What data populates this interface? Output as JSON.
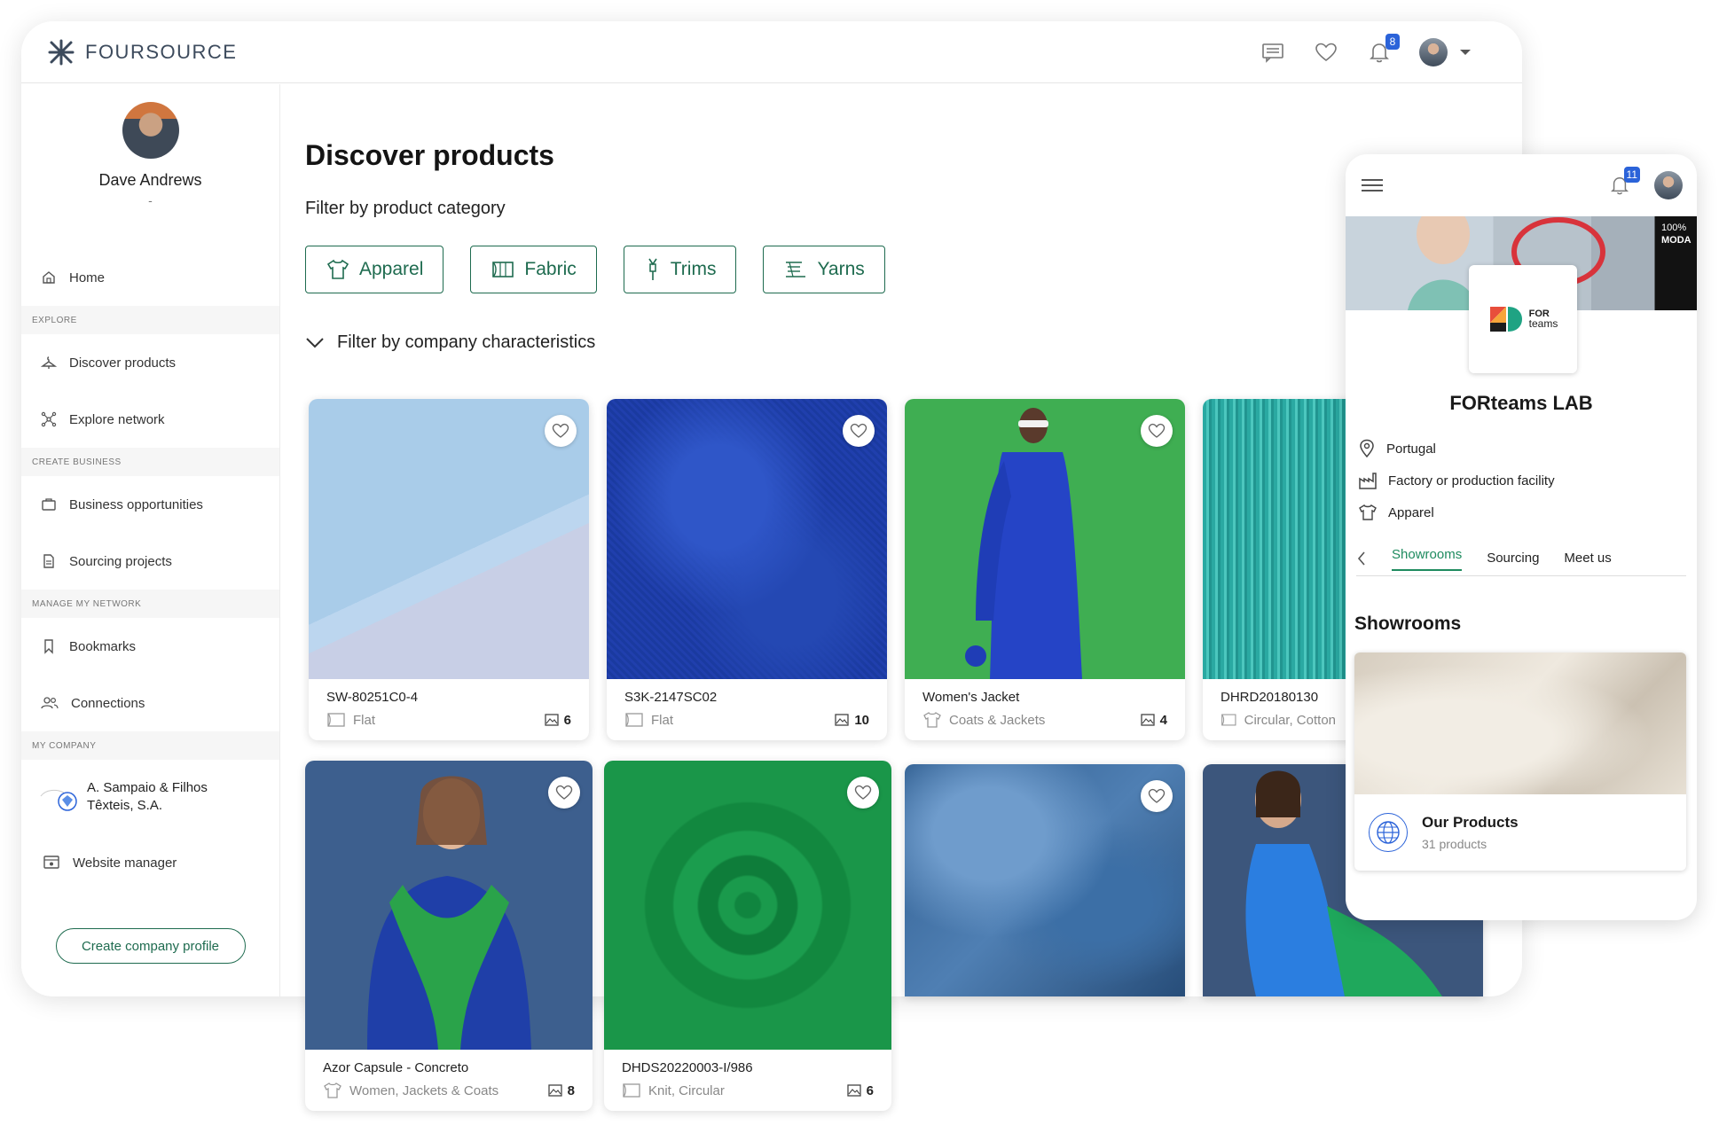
{
  "brand": {
    "name": "FOURSOURCE"
  },
  "topbar": {
    "notification_count": "8"
  },
  "sidebar": {
    "user_name": "Dave Andrews",
    "user_sub": "-",
    "home": "Home",
    "sections": {
      "explore": "Explore",
      "create_business": "Create business",
      "manage_network": "Manage my network",
      "my_company": "My company"
    },
    "items": {
      "discover": "Discover products",
      "explore_network": "Explore network",
      "business_opportunities": "Business opportunities",
      "sourcing_projects": "Sourcing projects",
      "bookmarks": "Bookmarks",
      "connections": "Connections",
      "website_manager": "Website manager"
    },
    "company_name": "A. Sampaio & Filhos Têxteis, S.A.",
    "create_profile_button": "Create company profile"
  },
  "main": {
    "title": "Discover products",
    "filter_category_label": "Filter by product category",
    "categories": [
      "Apparel",
      "Fabric",
      "Trims",
      "Yarns"
    ],
    "filter_company_label": "Filter by company characteristics"
  },
  "products": [
    {
      "code": "SW-80251C0-4",
      "meta": "Flat",
      "count": "6"
    },
    {
      "code": "S3K-2147SC02",
      "meta": "Flat",
      "count": "10"
    },
    {
      "code": "Women's Jacket",
      "meta": "Coats & Jackets",
      "count": "4"
    },
    {
      "code": "DHRD20180130",
      "meta": "Circular, Cotton",
      "count": ""
    },
    {
      "code": "Azor Capsule - Concreto",
      "meta": "Women, Jackets & Coats",
      "count": "8"
    },
    {
      "code": "DHDS20220003-I/986",
      "meta": "Knit, Circular",
      "count": "6"
    }
  ],
  "mobile": {
    "notification_count": "11",
    "banner_text": {
      "top": "100%",
      "bottom": "MODA"
    },
    "logo_text": {
      "line1": "FOR",
      "line2": "teams"
    },
    "company_name": "FORteams LAB",
    "attributes": {
      "location": "Portugal",
      "type": "Factory or production facility",
      "category": "Apparel"
    },
    "tabs": [
      "Showrooms",
      "Sourcing",
      "Meet us"
    ],
    "section_title": "Showrooms",
    "showroom": {
      "title": "Our Products",
      "subtitle": "31 products"
    }
  },
  "colors": {
    "accent": "#1e6b4f",
    "active_tab": "#1e8b5f",
    "badge": "#2b63d9"
  }
}
